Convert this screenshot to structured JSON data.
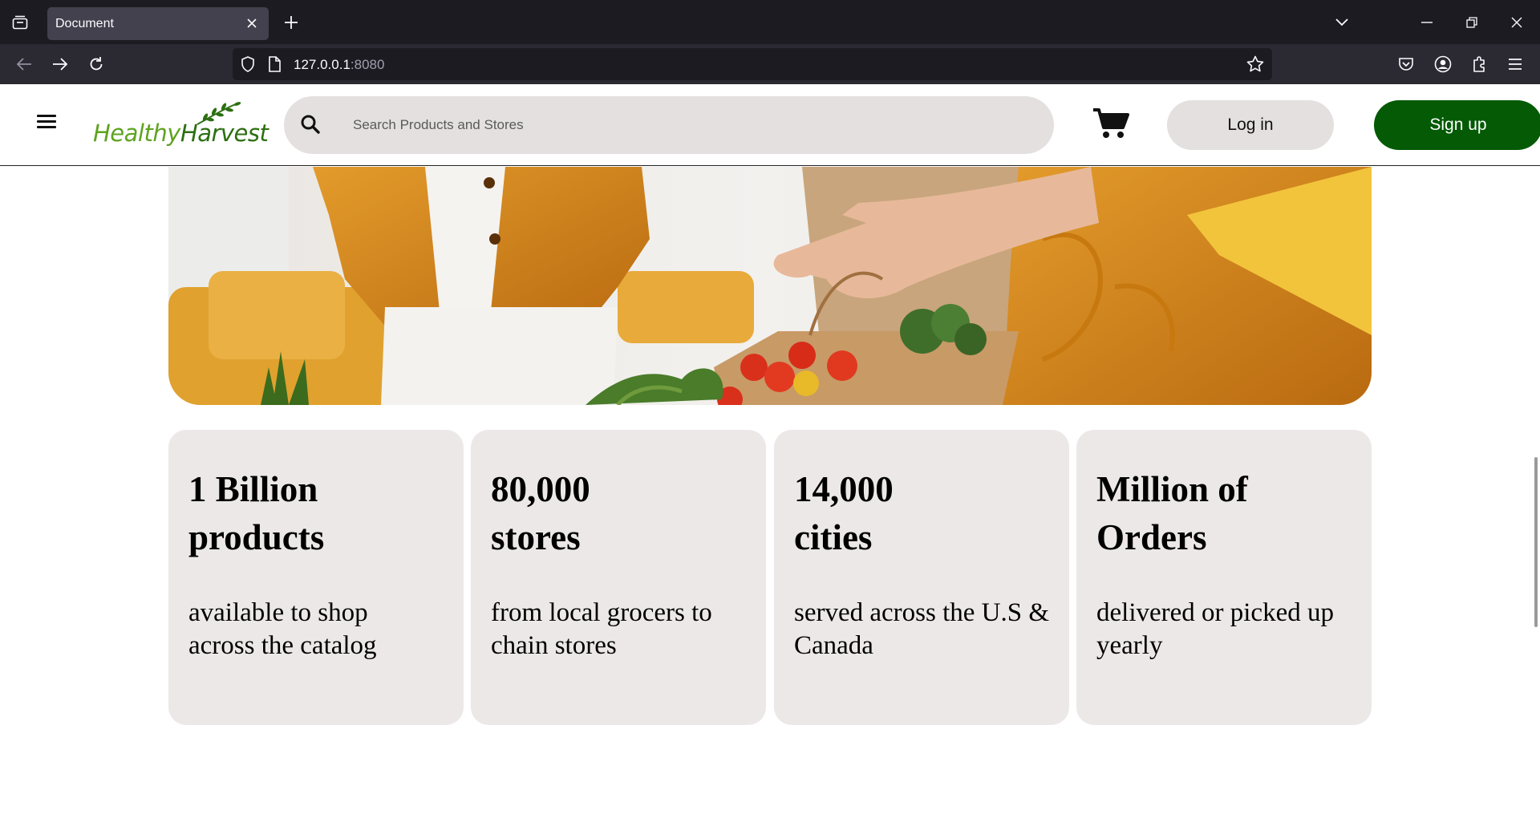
{
  "browser": {
    "tab_title": "Document",
    "url_host": "127.0.0.1",
    "url_port": ":8080"
  },
  "header": {
    "logo_part1": "Healthy",
    "logo_part2": "Harvest",
    "search_placeholder": "Search Products and Stores",
    "login_label": "Log in",
    "signup_label": "Sign up"
  },
  "stats": [
    {
      "title_line1": "1 Billion",
      "title_line2": "products",
      "desc": "available to shop across the catalog"
    },
    {
      "title_line1": "80,000",
      "title_line2": "stores",
      "desc": "from local grocers to chain stores"
    },
    {
      "title_line1": "14,000",
      "title_line2": "cities",
      "desc": "served across the U.S & Canada"
    },
    {
      "title_line1": "Million of",
      "title_line2": "Orders",
      "desc": "delivered or picked up yearly"
    }
  ],
  "colors": {
    "brand_green": "#045a05",
    "logo_light_green": "#5fa31f",
    "card_bg": "#ede8e8",
    "search_bg": "#e4e0e0"
  }
}
